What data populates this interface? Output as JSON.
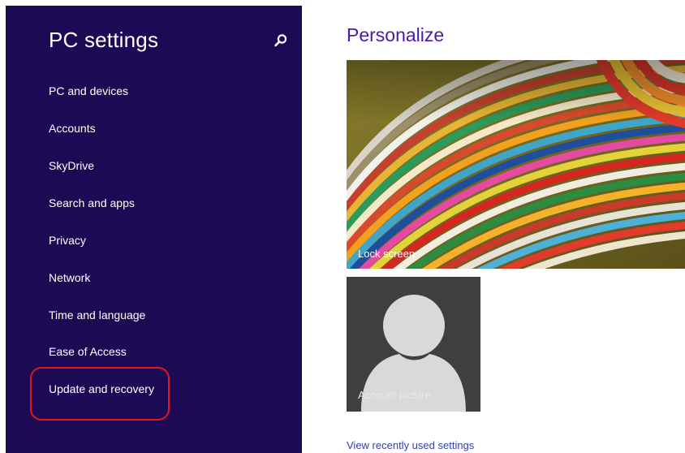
{
  "sidebar": {
    "title": "PC settings",
    "search_icon": "search-icon",
    "items": [
      {
        "label": "PC and devices"
      },
      {
        "label": "Accounts"
      },
      {
        "label": "SkyDrive"
      },
      {
        "label": "Search and apps"
      },
      {
        "label": "Privacy"
      },
      {
        "label": "Network"
      },
      {
        "label": "Time and language"
      },
      {
        "label": "Ease of Access"
      },
      {
        "label": "Update and recovery",
        "highlighted": true
      }
    ]
  },
  "main": {
    "title": "Personalize",
    "tiles": {
      "lock_screen": {
        "label": "Lock screen"
      },
      "account_picture": {
        "label": "Account picture"
      }
    },
    "recent_link": "View recently used settings"
  },
  "colors": {
    "sidebar_bg": "#1c0a55",
    "title_accent": "#4a1aa8",
    "link": "#2f3fb5",
    "highlight_ring": "#e3161b"
  }
}
